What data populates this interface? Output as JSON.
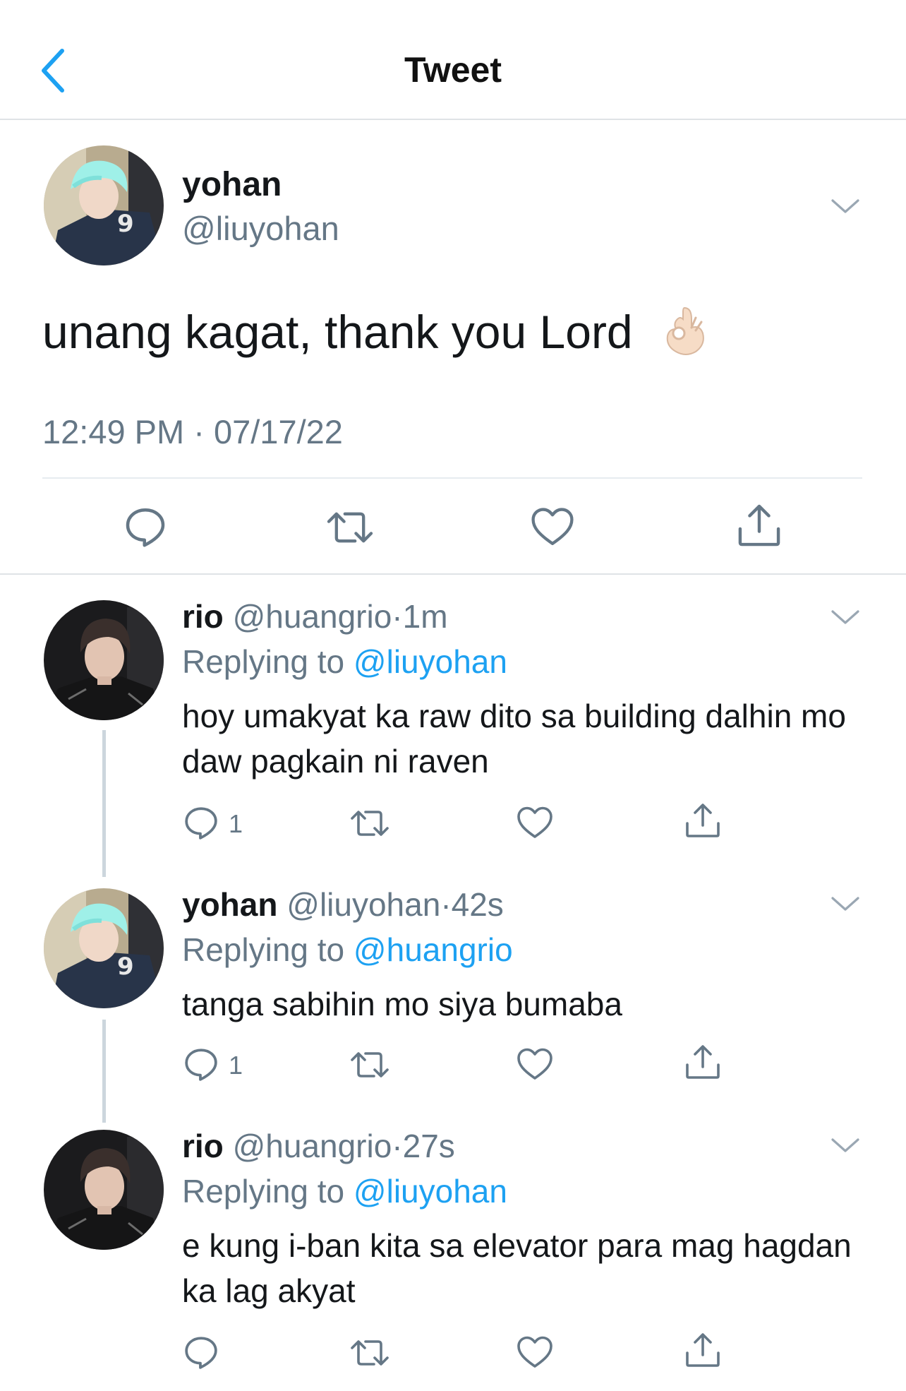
{
  "header": {
    "title": "Tweet",
    "back_icon": "chevron-left-icon",
    "accent_color": "#1da1f2"
  },
  "main_tweet": {
    "name": "yohan",
    "handle": "@liuyohan",
    "text": "unang kagat, thank you Lord",
    "emoji": "ok-hand-emoji",
    "time": "12:49 PM",
    "separator": "·",
    "date": "07/17/22",
    "actions": [
      "reply-icon",
      "retweet-icon",
      "like-icon",
      "share-icon"
    ]
  },
  "replies": [
    {
      "name": "rio",
      "handle": "@huangrio",
      "sep": "·",
      "time": "1m",
      "replying_prefix": "Replying to",
      "replying_to": "@liuyohan",
      "text": "hoy umakyat ka raw dito sa building dalhin mo daw pagkain ni raven",
      "reply_count": "1"
    },
    {
      "name": "yohan",
      "handle": "@liuyohan",
      "sep": "·",
      "time": "42s",
      "replying_prefix": "Replying to",
      "replying_to": "@huangrio",
      "text": "tanga sabihin mo siya bumaba",
      "reply_count": "1"
    },
    {
      "name": "rio",
      "handle": "@huangrio",
      "sep": "·",
      "time": "27s",
      "replying_prefix": "Replying to",
      "replying_to": "@liuyohan",
      "text": "e kung i-ban kita sa elevator para mag hagdan ka lag akyat",
      "reply_count": ""
    }
  ]
}
